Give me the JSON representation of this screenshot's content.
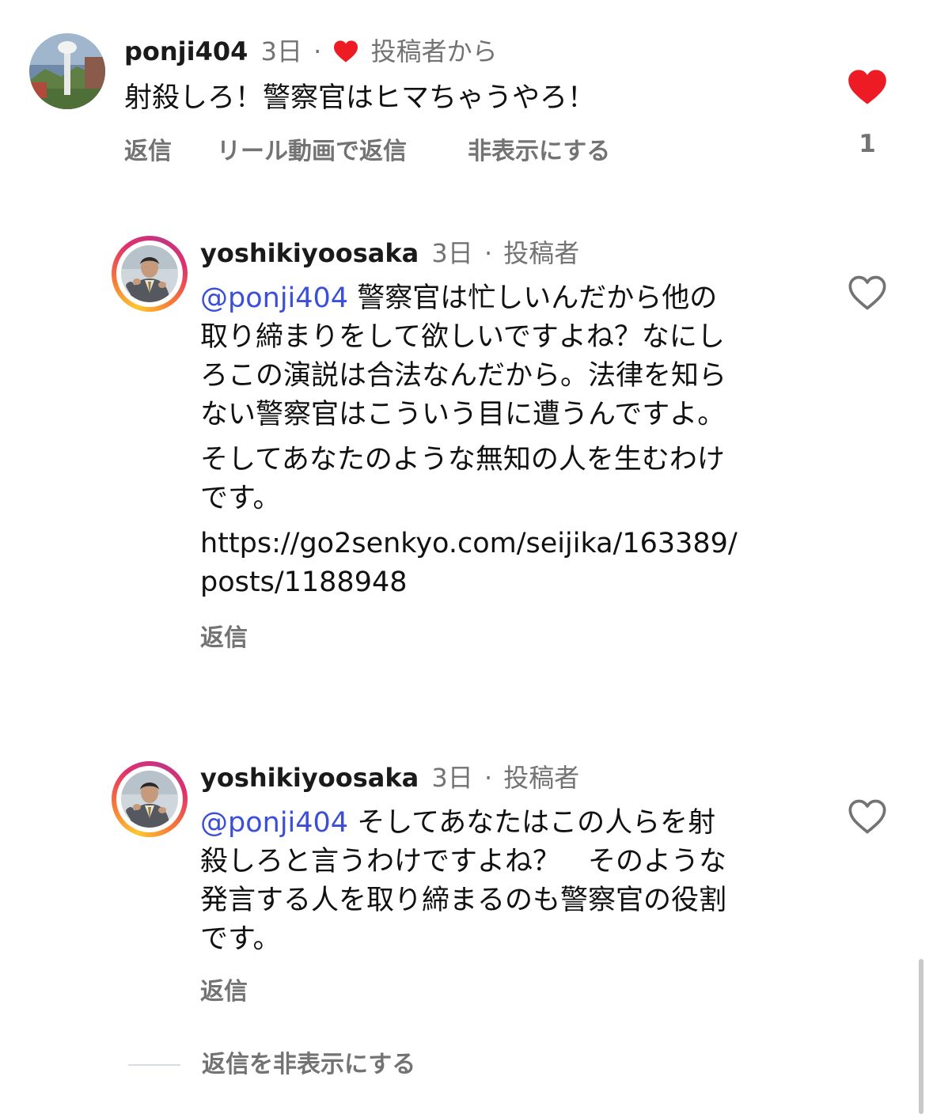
{
  "comments": [
    {
      "username": "ponji404",
      "time": "3日",
      "separator": "·",
      "author_badge": "投稿者から",
      "text": "射殺しろ！警察官はヒマちゃうやろ！",
      "actions": [
        "返信",
        "リール動画で返信",
        "非表示にする"
      ],
      "likes": "1",
      "liked": true
    },
    {
      "username": "yoshikiyoosaka",
      "time": "3日",
      "separator": "·",
      "author_badge": "投稿者",
      "mention": "@ponji404",
      "text_lines": [
        " 警察官は忙しいんだから他の",
        "取り締まりをして欲しいですよね？なにし",
        "ろこの演説は合法なんだから。法律を知ら",
        "ない警察官はこういう目に遭うんですよ。"
      ],
      "para2_lines": [
        "そしてあなたのような無知の人を生むわけ",
        "です。"
      ],
      "link_lines": [
        "https://go2senkyo.com/seijika/163389/",
        "posts/1188948"
      ],
      "reply_label": "返信",
      "liked": false
    },
    {
      "username": "yoshikiyoosaka",
      "time": "3日",
      "separator": "·",
      "author_badge": "投稿者",
      "mention": "@ponji404",
      "text_lines": [
        " そしてあなたはこの人らを射",
        "殺しろと言うわけですよね？　そのような",
        "発言する人を取り締まるのも警察官の役割",
        "です。"
      ],
      "reply_label": "返信",
      "liked": false
    }
  ],
  "hide_replies_label": "返信を非表示にする",
  "colors": {
    "heart_red": "#ed1c24",
    "mention_blue": "#3b4fd8",
    "meta_gray": "#737373"
  },
  "icons": {
    "like_filled": "heart-filled-icon",
    "like_outline": "heart-outline-icon"
  }
}
